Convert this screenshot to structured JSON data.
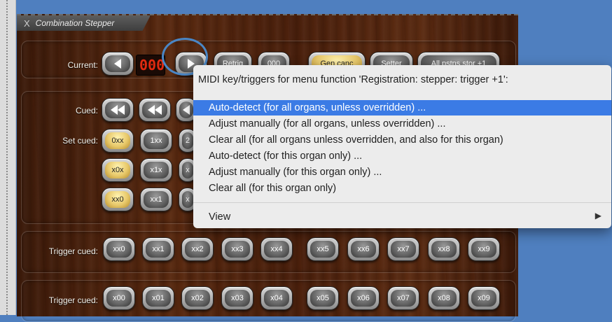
{
  "window": {
    "title": "Combination Stepper",
    "close_glyph": "X"
  },
  "current_row": {
    "label": "Current:",
    "display_value": "000",
    "buttons": [
      "Retrig",
      "000",
      "Gen canc",
      "Setter",
      "All pstns stor +1"
    ]
  },
  "cued_row": {
    "label": "Cued:"
  },
  "set_cued": {
    "label": "Set cued:",
    "row1": [
      "0xx",
      "1xx",
      "2"
    ],
    "row2": [
      "x0x",
      "x1x",
      "x"
    ],
    "row3": [
      "xx0",
      "xx1",
      "x"
    ]
  },
  "trigger_rows": [
    {
      "label": "Trigger cued:",
      "buttons": [
        "xx0",
        "xx1",
        "xx2",
        "xx3",
        "xx4",
        "xx5",
        "xx6",
        "xx7",
        "xx8",
        "xx9"
      ]
    },
    {
      "label": "Trigger cued:",
      "buttons": [
        "x00",
        "x01",
        "x02",
        "x03",
        "x04",
        "x05",
        "x06",
        "x07",
        "x08",
        "x09"
      ]
    }
  ],
  "context_menu": {
    "header": "MIDI key/triggers for menu function 'Registration: stepper: trigger +1':",
    "items": [
      "Auto-detect (for all organs, unless overridden) ...",
      "Adjust manually (for all organs, unless overridden) ...",
      "Clear all (for all organs unless overridden, and also for this organ)",
      "Auto-detect (for this organ only) ...",
      "Adjust manually (for this organ only) ...",
      "Clear all (for this organ only)"
    ],
    "view_label": "View",
    "view_arrow": "▶"
  },
  "colors": {
    "highlight": "#3b7be5",
    "circle": "#4a86c5",
    "display_red": "#e02a10"
  }
}
